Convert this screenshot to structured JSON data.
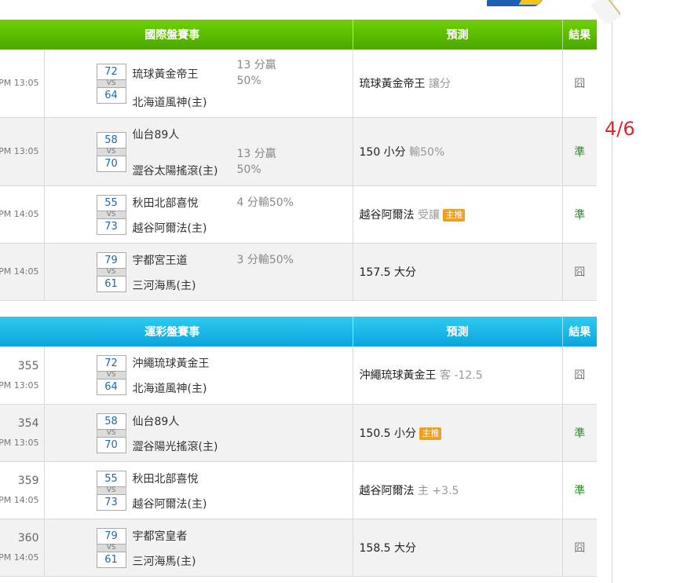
{
  "annotation": "4/6",
  "intl": {
    "header": {
      "games": "國際盤賽事",
      "prediction": "預測",
      "result": "結果"
    },
    "rows": [
      {
        "time": "PM 13:05",
        "away_score": "72",
        "home_score": "64",
        "vs": "VS",
        "away": "琉球黃金帝王",
        "home": "北海道風神(主)",
        "spread_line1": "13 分贏",
        "spread_line2": "50%",
        "pick": "琉球黃金帝王",
        "pick_sub": "讓分",
        "badge": "",
        "result": "囧"
      },
      {
        "time": "PM 13:05",
        "away_score": "58",
        "home_score": "70",
        "vs": "VS",
        "away": "仙台89人",
        "home": "澀谷太陽搖滾(主)",
        "spread_line1": "13 分贏",
        "spread_line2": "50%",
        "pick": "150 小分",
        "pick_sub": "輸50%",
        "badge": "",
        "result": "準"
      },
      {
        "time": "PM 14:05",
        "away_score": "55",
        "home_score": "73",
        "vs": "VS",
        "away": "秋田北部喜悅",
        "home": "越谷阿爾法(主)",
        "spread_line1": "4 分輸50%",
        "spread_line2": "",
        "pick": "越谷阿爾法",
        "pick_sub": "受讓",
        "badge": "主推",
        "result": "準"
      },
      {
        "time": "PM 14:05",
        "away_score": "79",
        "home_score": "61",
        "vs": "VS",
        "away": "宇都宮王道",
        "home": "三河海馬(主)",
        "spread_line1": "3 分輸50%",
        "spread_line2": "",
        "pick": "157.5 大分",
        "pick_sub": "",
        "badge": "",
        "result": "囧"
      }
    ]
  },
  "sports": {
    "header": {
      "games": "運彩盤賽事",
      "prediction": "預測",
      "result": "結果"
    },
    "rows": [
      {
        "num": "355",
        "time": "PM 13:05",
        "away_score": "72",
        "home_score": "64",
        "vs": "VS",
        "away": "沖繩琉球黃金王",
        "home": "北海道風神(主)",
        "pick": "沖繩琉球黃金王",
        "pick_sub": "客 -12.5",
        "badge": "",
        "result": "囧"
      },
      {
        "num": "354",
        "time": "PM 13:05",
        "away_score": "58",
        "home_score": "70",
        "vs": "VS",
        "away": "仙台89人",
        "home": "澀谷陽光搖滾(主)",
        "pick": "150.5 小分",
        "pick_sub": "",
        "badge": "主推",
        "result": "準"
      },
      {
        "num": "359",
        "time": "PM 14:05",
        "away_score": "55",
        "home_score": "73",
        "vs": "VS",
        "away": "秋田北部喜悅",
        "home": "越谷阿爾法(主)",
        "pick": "越谷阿爾法",
        "pick_sub": "主 +3.5",
        "badge": "",
        "result": "準"
      },
      {
        "num": "360",
        "time": "PM 14:05",
        "away_score": "79",
        "home_score": "61",
        "vs": "VS",
        "away": "宇都宮皇者",
        "home": "三河海馬(主)",
        "pick": "158.5 大分",
        "pick_sub": "",
        "badge": "",
        "result": "囧"
      }
    ]
  }
}
